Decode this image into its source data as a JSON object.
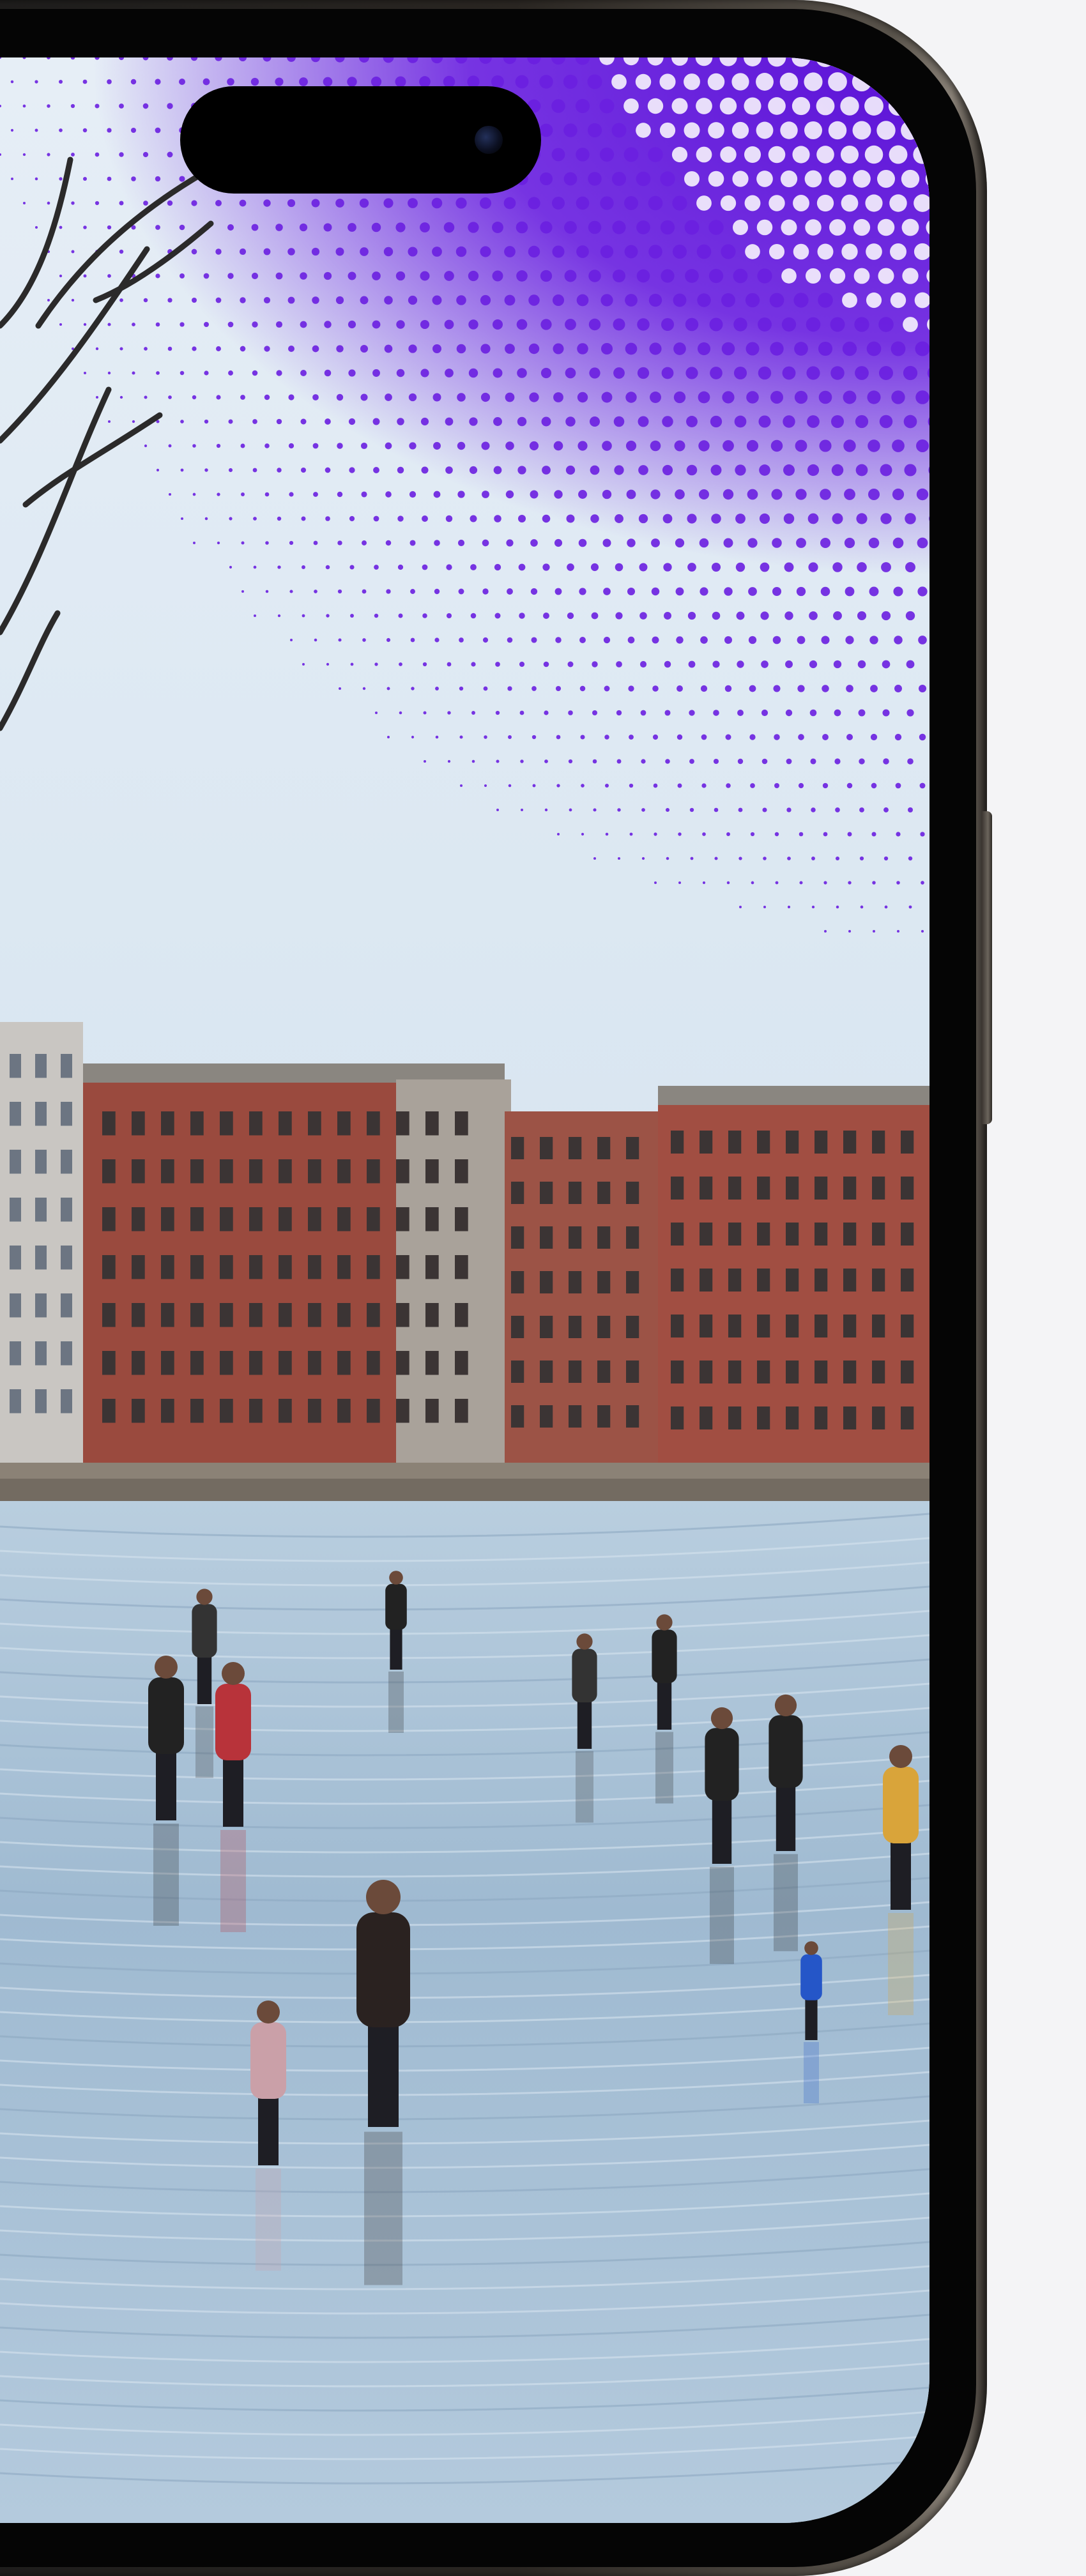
{
  "scene": {
    "subject": "phone-wallpaper-photo",
    "colors": {
      "halftone": "#6a1fe0",
      "halftone_dark": "#5a10d6",
      "sky": "#dfe9f3",
      "ice": "#a9c3d8",
      "building_brick": "#9a4a3e",
      "building_light": "#c9c6c2",
      "frame": "#2a2622"
    }
  }
}
